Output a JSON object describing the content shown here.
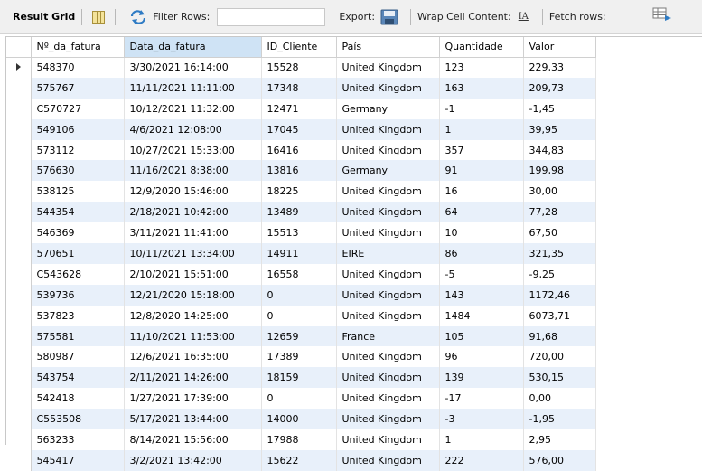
{
  "toolbar": {
    "result_grid_label": "Result Grid",
    "filter_label": "Filter Rows:",
    "filter_value": "",
    "export_label": "Export:",
    "wrap_label": "Wrap Cell Content:",
    "wrap_icon_text": "IA",
    "fetch_label": "Fetch rows:"
  },
  "columns": [
    "Nº_da_fatura",
    "Data_da_fatura",
    "ID_Cliente",
    "País",
    "Quantidade",
    "Valor"
  ],
  "rows": [
    [
      "548370",
      "3/30/2021 16:14:00",
      "15528",
      "United Kingdom",
      "123",
      "229,33"
    ],
    [
      "575767",
      "11/11/2021 11:11:00",
      "17348",
      "United Kingdom",
      "163",
      "209,73"
    ],
    [
      "C570727",
      "10/12/2021 11:32:00",
      "12471",
      "Germany",
      "-1",
      "-1,45"
    ],
    [
      "549106",
      "4/6/2021 12:08:00",
      "17045",
      "United Kingdom",
      "1",
      "39,95"
    ],
    [
      "573112",
      "10/27/2021 15:33:00",
      "16416",
      "United Kingdom",
      "357",
      "344,83"
    ],
    [
      "576630",
      "11/16/2021 8:38:00",
      "13816",
      "Germany",
      "91",
      "199,98"
    ],
    [
      "538125",
      "12/9/2020 15:46:00",
      "18225",
      "United Kingdom",
      "16",
      "30,00"
    ],
    [
      "544354",
      "2/18/2021 10:42:00",
      "13489",
      "United Kingdom",
      "64",
      "77,28"
    ],
    [
      "546369",
      "3/11/2021 11:41:00",
      "15513",
      "United Kingdom",
      "10",
      "67,50"
    ],
    [
      "570651",
      "10/11/2021 13:34:00",
      "14911",
      "EIRE",
      "86",
      "321,35"
    ],
    [
      "C543628",
      "2/10/2021 15:51:00",
      "16558",
      "United Kingdom",
      "-5",
      "-9,25"
    ],
    [
      "539736",
      "12/21/2020 15:18:00",
      "0",
      "United Kingdom",
      "143",
      "1172,46"
    ],
    [
      "537823",
      "12/8/2020 14:25:00",
      "0",
      "United Kingdom",
      "1484",
      "6073,71"
    ],
    [
      "575581",
      "11/10/2021 11:53:00",
      "12659",
      "France",
      "105",
      "91,68"
    ],
    [
      "580987",
      "12/6/2021 16:35:00",
      "17389",
      "United Kingdom",
      "96",
      "720,00"
    ],
    [
      "543754",
      "2/11/2021 14:26:00",
      "18159",
      "United Kingdom",
      "139",
      "530,15"
    ],
    [
      "542418",
      "1/27/2021 17:39:00",
      "0",
      "United Kingdom",
      "-17",
      "0,00"
    ],
    [
      "C553508",
      "5/17/2021 13:44:00",
      "14000",
      "United Kingdom",
      "-3",
      "-1,95"
    ],
    [
      "563233",
      "8/14/2021 15:56:00",
      "17988",
      "United Kingdom",
      "1",
      "2,95"
    ],
    [
      "545417",
      "3/2/2021 13:42:00",
      "15622",
      "United Kingdom",
      "222",
      "576,00"
    ]
  ],
  "selected_row": 0,
  "sorted_column": 1,
  "icons": {
    "grid": "grid-icon",
    "filter": "filter-icon",
    "export": "export-icon",
    "wrap": "wrap-icon",
    "fetch": "fetch-icon",
    "row_pointer": "row-pointer-icon"
  },
  "colors": {
    "toolbar_bg": "#f0f0f0",
    "alt_row": "#e8f0fa",
    "sorted_header": "#cfe3f5",
    "filter_arrows": "#2e7bc4"
  }
}
